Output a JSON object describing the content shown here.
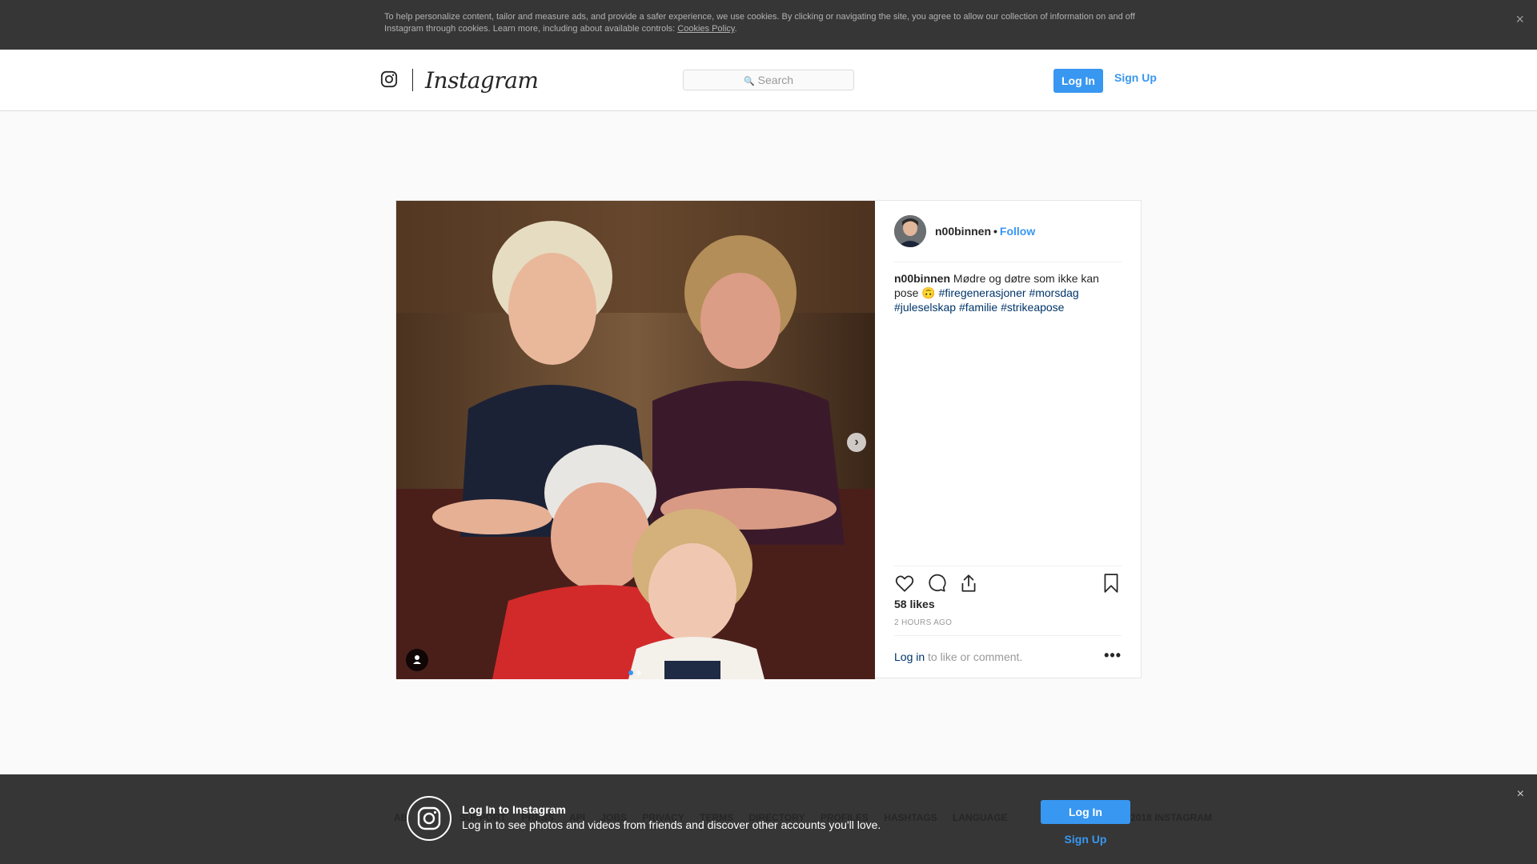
{
  "cookie_banner": {
    "text": "To help personalize content, tailor and measure ads, and provide a safer experience, we use cookies. By clicking or navigating the site, you agree to allow our collection of information on and off Instagram through cookies. Learn more, including about available controls: ",
    "link": "Cookies Policy",
    "link_suffix": ".",
    "close": "×"
  },
  "header": {
    "wordmark": "Instagram",
    "search_placeholder": "Search",
    "login_label": "Log In",
    "signup_label": "Sign Up"
  },
  "post": {
    "username": "n00binnen",
    "separator": "•",
    "follow_label": "Follow",
    "caption_user": "n00binnen",
    "caption_text": " Mødre og døtre som ikke kan pose 🙃 ",
    "hashtags": [
      "#firegenerasjoner",
      "#morsdag",
      "#juleselskap",
      "#familie",
      "#strikeapose"
    ],
    "likes": "58 likes",
    "time": "2 HOURS AGO",
    "login_link": "Log in",
    "comment_prompt": " to like or comment.",
    "more": "•••",
    "next_arrow": "›",
    "carousel_dots": 2,
    "carousel_active": 0
  },
  "footer": {
    "links": [
      "ABOUT US",
      "SUPPORT",
      "PRESS",
      "API",
      "JOBS",
      "PRIVACY",
      "TERMS",
      "DIRECTORY",
      "PROFILES",
      "HASHTAGS",
      "LANGUAGE"
    ],
    "copyright": "© 2018 INSTAGRAM"
  },
  "login_bar": {
    "title": "Log In to Instagram",
    "subtitle": "Log in to see photos and videos from friends and discover other accounts you'll love.",
    "login_label": "Log In",
    "signup_label": "Sign Up",
    "close": "×"
  },
  "icons": {
    "camera": "instagram-camera-icon",
    "search": "search-icon",
    "like": "heart-icon",
    "comment": "comment-icon",
    "share": "share-icon",
    "save": "bookmark-icon",
    "tag": "user-tag-icon"
  },
  "colors": {
    "accent": "#3897f0",
    "hashtag": "#003569",
    "banner_bg": "#363636"
  }
}
